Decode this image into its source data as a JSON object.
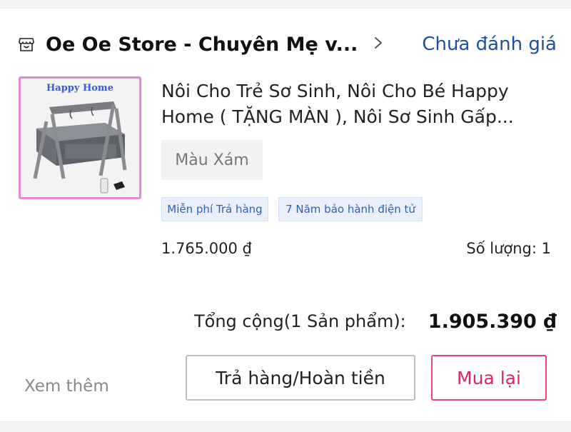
{
  "shop": {
    "icon": "store-icon",
    "name": "Oe Oe Store - Chuyên Mẹ v...",
    "chevron_icon": "chevron-right-icon",
    "rating_status": "Chưa đánh giá"
  },
  "product": {
    "image_brand_text": "Happy Home",
    "title_line1": "Nôi Cho Trẻ Sơ Sinh, Nôi Cho Bé Happy",
    "title_line2": "Home ( TẶNG MÀN ), Nôi Sơ Sinh Gấp...",
    "variant": "Màu Xám",
    "tags": [
      "Miễn phí Trả hàng",
      "7 Năm bảo hành điện tử"
    ],
    "price": "1.765.000 ₫",
    "quantity_label": "Số lượng: 1"
  },
  "summary": {
    "total_label": "Tổng cộng(1 Sản phẩm):",
    "total_value": "1.905.390 ₫"
  },
  "actions": {
    "see_more": "Xem thêm",
    "return_refund": "Trả hàng/Hoàn tiền",
    "buy_again": "Mua lại"
  },
  "colors": {
    "link_blue": "#1e4fa0",
    "accent_pink": "#d8285f",
    "tag_blue": "#2d5fb8"
  }
}
